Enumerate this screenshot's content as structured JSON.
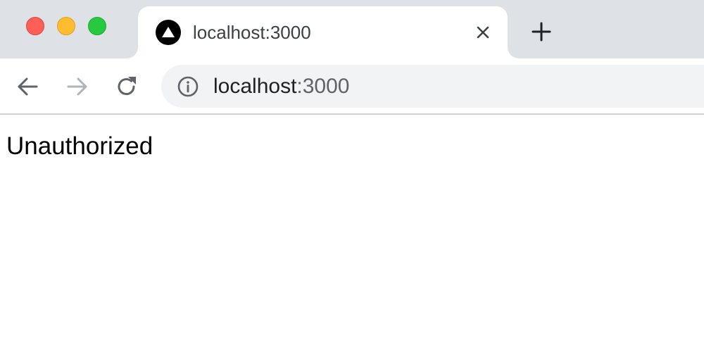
{
  "window": {
    "traffic_lights": {
      "close_color": "#fe5f57",
      "minimize_color": "#febc2e",
      "maximize_color": "#28c840"
    }
  },
  "tab": {
    "title": "localhost:3000",
    "favicon": "nextjs-triangle-icon",
    "close_icon": "close-icon"
  },
  "toolbar": {
    "back_icon": "arrow-left-icon",
    "forward_icon": "arrow-right-icon",
    "reload_icon": "reload-icon",
    "new_tab_icon": "plus-icon"
  },
  "address_bar": {
    "info_icon": "info-icon",
    "host": "localhost",
    "port": ":3000"
  },
  "page": {
    "message": "Unauthorized"
  }
}
